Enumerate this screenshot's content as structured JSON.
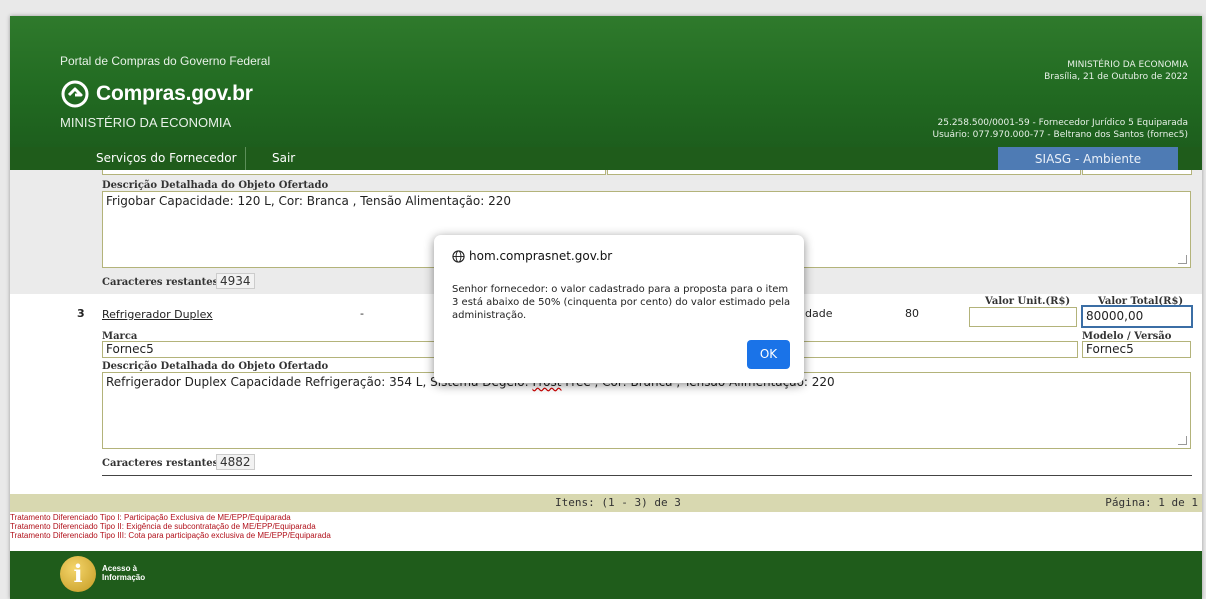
{
  "header": {
    "portal_title": "Portal de Compras do Governo Federal",
    "logo_text": "Compras.gov.br",
    "ministry_left": "MINISTÉRIO DA ECONOMIA",
    "ministry_right": "MINISTÉRIO DA ECONOMIA",
    "date_line": "Brasília, 21 de Outubro de 2022",
    "supplier_line": "25.258.500/0001-59 - Fornecedor Jurídico 5 Equiparada",
    "user_line": "Usuário: 077.970.000-77 - Beltrano dos Santos (fornec5)"
  },
  "nav": {
    "services": "Serviços do Fornecedor",
    "logout": "Sair",
    "environment": "SIASG - Ambiente Homologação"
  },
  "item2": {
    "description_label": "Descrição Detalhada do Objeto Ofertado",
    "description": "Frigobar Capacidade: 120 L, Cor: Branca , Tensão Alimentação: 220",
    "remaining_label": "Caracteres restantes:",
    "remaining": "4934"
  },
  "item3": {
    "number": "3",
    "name": "Refrigerador Duplex",
    "dash": "-",
    "unit_partial": "dade",
    "quantity": "80",
    "unit_value_label": "Valor Unit.(R$)",
    "unit_value": "",
    "total_value_label": "Valor Total(R$)",
    "total_value": "80000,00",
    "brand_label": "Marca",
    "brand": "Fornec5",
    "model_label": "Modelo / Versão",
    "model": "Fornec5",
    "description_label": "Descrição Detalhada do Objeto Ofertado",
    "description_start": "Refrigerador Duplex Capacidade Refrigeração: 354 L, Siste",
    "description_hidden": "ma Degelo: ",
    "description_spell": "Frost",
    "description_end": " Free , Cor: Branca , Tensão Alimentação: 220",
    "remaining_label": "Caracteres restantes:",
    "remaining": "4882"
  },
  "pager": {
    "items": "Itens: (1 - 3) de 3",
    "page": "Página: 1 de 1"
  },
  "legend": {
    "type1": "Tratamento Diferenciado Tipo I: Participação Exclusiva de ME/EPP/Equiparada",
    "type2": "Tratamento Diferenciado Tipo II: Exigência de subcontratação de ME/EPP/Equiparada",
    "type3": "Tratamento Diferenciado Tipo III: Cota para participação exclusiva de ME/EPP/Equiparada"
  },
  "footer": {
    "access_line1": "Acesso à",
    "access_line2": "Informação"
  },
  "modal": {
    "host": "hom.comprasnet.gov.br",
    "message": "Senhor fornecedor: o valor cadastrado para a proposta para o item 3 está abaixo de 50% (cinquenta por cento) do valor estimado pela administração.",
    "ok_label": "OK"
  },
  "colors": {
    "header_green": "#226b22",
    "nav_green": "#1f5c1b",
    "env_blue": "#4e7bb4",
    "ok_blue": "#1a73e8",
    "legend_red": "#b1111b"
  }
}
